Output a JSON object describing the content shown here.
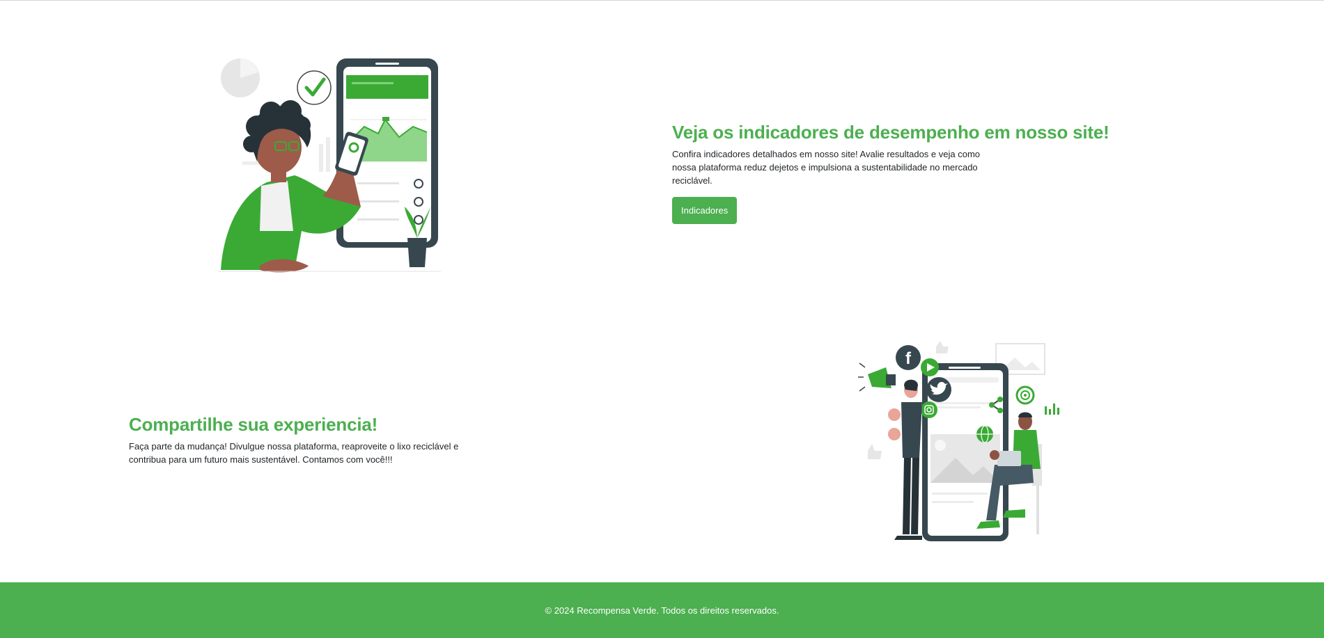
{
  "section1": {
    "title": "Veja os indicadores de desempenho em nosso site!",
    "description": "Confira indicadores detalhados em nosso site! Avalie resultados e veja como nossa plataforma reduz dejetos e impulsiona a sustentabilidade no mercado reciclável.",
    "button_label": "Indicadores"
  },
  "section2": {
    "title": "Compartilhe sua experiencia!",
    "description": "Faça parte da mudança! Divulgue nossa plataforma, reaproveite o lixo reciclável e contribua para um futuro mais sustentável. Contamos com você!!!"
  },
  "footer": {
    "copyright": "© 2024 Recompensa Verde. Todos os direitos reservados."
  },
  "colors": {
    "accent": "#4caf50",
    "dark": "#37474f",
    "illustration_green": "#3aaa35"
  },
  "icons": [
    "facebook-icon",
    "twitter-icon",
    "instagram-icon",
    "youtube-icon",
    "share-icon",
    "globe-icon",
    "target-icon",
    "megaphone-icon",
    "check-icon"
  ]
}
